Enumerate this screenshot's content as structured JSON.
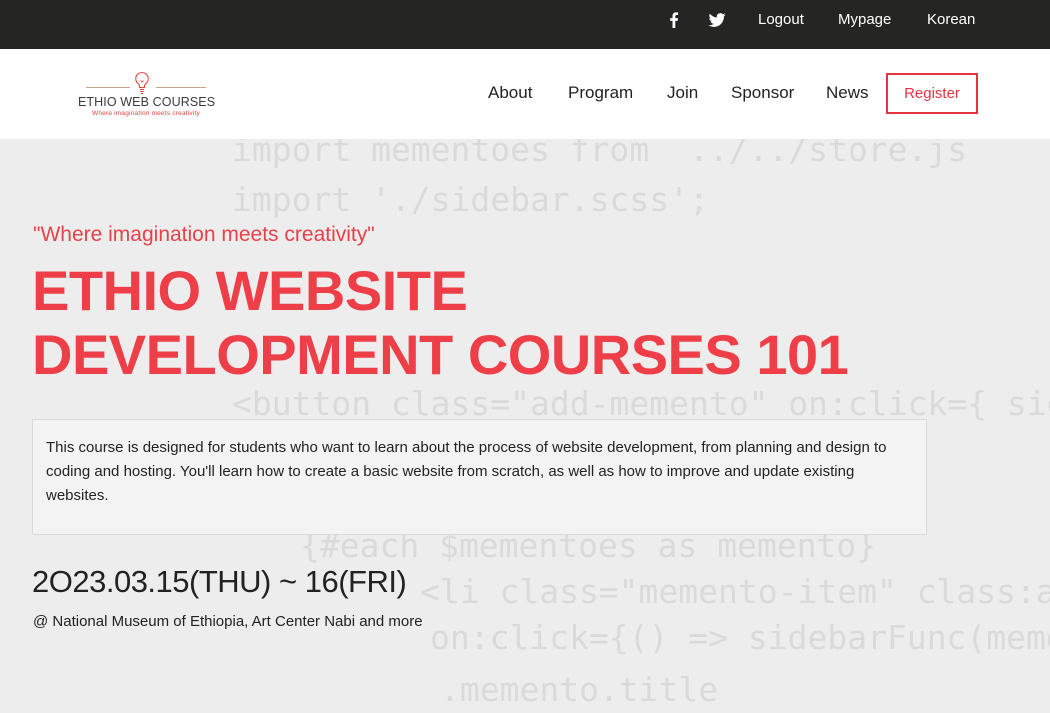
{
  "topbar": {
    "icons": [
      "facebook-icon",
      "twitter-icon"
    ],
    "links": [
      "Logout",
      "Mypage",
      "Korean"
    ]
  },
  "navbar": {
    "logo": {
      "title": "ETHIO WEB COURSES",
      "tagline": "Where imagination meets creativity",
      "icon": "lightbulb-icon"
    },
    "items": [
      "About",
      "Program",
      "Join",
      "Sponsor",
      "News"
    ],
    "register_label": "Register"
  },
  "hero": {
    "tagline": "\"Where imagination meets creativity\"",
    "title_line1": "ETHIO WEBSITE",
    "title_line2": "DEVELOPMENT COURSES 101",
    "description": "This course is designed for students who want to learn about the process of website development, from planning and design to coding and hosting. You'll learn how to create a basic website from scratch, as well as how to improve and update existing websites.",
    "date": "2O23.03.15(THU) ~ 16(FRI)",
    "venue": "@ National Museum of Ethiopia, Art Center Nabi and more"
  },
  "colors": {
    "topbar_bg": "#252624",
    "accent": "#e8414a",
    "hero_bg": "#ededed"
  }
}
